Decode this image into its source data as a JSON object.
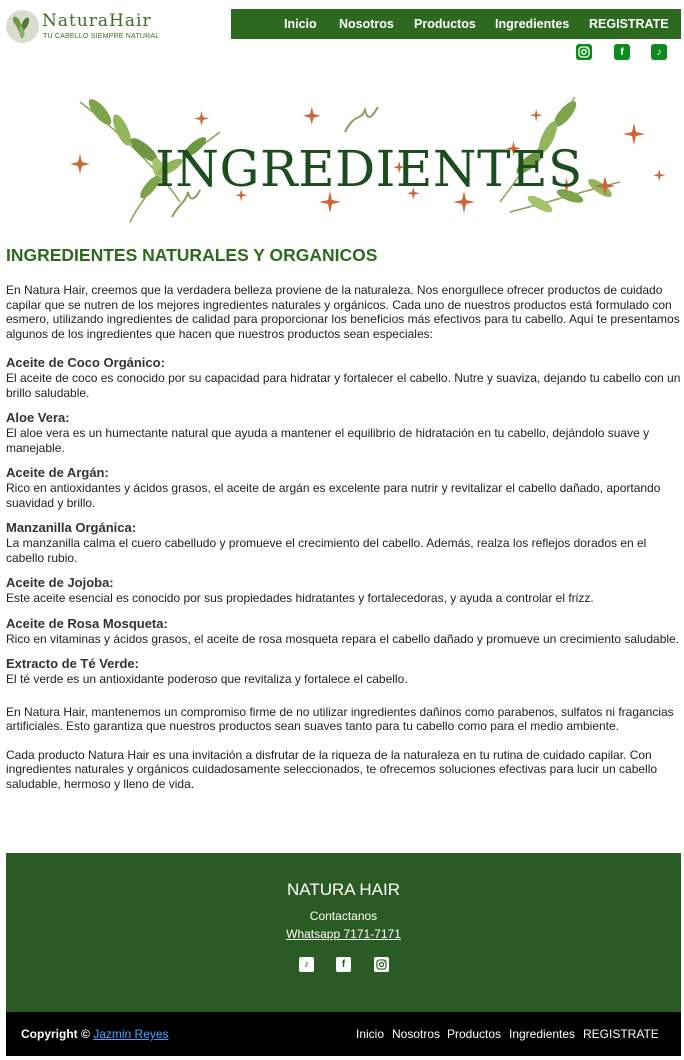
{
  "brand": {
    "name": "NaturaHair",
    "tagline": "TU CABELLO SIEMPRE NATURAL"
  },
  "nav": {
    "items": [
      "Inicio",
      "Nosotros",
      "Productos",
      "Ingredientes",
      "REGISTRATE"
    ]
  },
  "social": {
    "icons": [
      "instagram-icon",
      "facebook-icon",
      "tiktok-icon"
    ]
  },
  "banner": {
    "title": "INGREDIENTES"
  },
  "main": {
    "heading": "INGREDIENTES NATURALES Y ORGANICOS",
    "intro": "En Natura Hair, creemos que la verdadera belleza proviene de la naturaleza. Nos enorgullece ofrecer productos de cuidado capilar que se nutren de los mejores ingredientes naturales y orgánicos. Cada uno de nuestros productos está formulado con esmero, utilizando ingredientes de calidad para proporcionar los beneficios más efectivos para tu cabello. Aquí te presentamos algunos de los ingredientes que hacen que nuestros productos sean especiales:",
    "ingredients": [
      {
        "name": "Aceite de Coco Orgánico:",
        "desc": "El aceite de coco es conocido por su capacidad para hidratar y fortalecer el cabello. Nutre y suaviza, dejando tu cabello con un brillo saludable."
      },
      {
        "name": "Aloe Vera:",
        "desc": "El aloe vera es un humectante natural que ayuda a mantener el equilibrio de hidratación en tu cabello, dejándolo suave y manejable."
      },
      {
        "name": "Aceite de Argán:",
        "desc": "Rico en antioxidantes y ácidos grasos, el aceite de argán es excelente para nutrir y revitalizar el cabello dañado, aportando suavidad y brillo."
      },
      {
        "name": "Manzanilla Orgánica:",
        "desc": "La manzanilla calma el cuero cabelludo y promueve el crecimiento del cabello. Además, realza los reflejos dorados en el cabello rubio."
      },
      {
        "name": "Aceite de Jojoba:",
        "desc": "Este aceite esencial es conocido por sus propiedades hidratantes y fortalecedoras, y ayuda a controlar el frizz."
      },
      {
        "name": "Aceite de Rosa Mosqueta:",
        "desc": "Rico en vitaminas y ácidos grasos, el aceite de rosa mosqueta repara el cabello dañado y promueve un crecimiento saludable."
      },
      {
        "name": "Extracto de Té Verde:",
        "desc": "El té verde es un antioxidante poderoso que revitaliza y fortalece el cabello."
      }
    ],
    "commitment": "En Natura Hair, mantenemos un compromiso firme de no utilizar ingredientes dañinos como parabenos, sulfatos ni fragancias artificiales. Esto garantiza que nuestros productos sean suaves tanto para tu cabello como para el medio ambiente.",
    "closing": "Cada producto Natura Hair es una invitación a disfrutar de la riqueza de la naturaleza en tu rutina de cuidado capilar. Con ingredientes naturales y orgánicos cuidadosamente seleccionados, te ofrecemos soluciones efectivas para lucir un cabello saludable, hermoso y lleno de vida."
  },
  "footer": {
    "brand": "NATURA HAIR",
    "contact_label": "Contactanos",
    "phone": "Whatsapp 7171-7171",
    "copyright": "Copyright ©",
    "author": "Jazmin Reyes"
  },
  "colors": {
    "primary_green": "#2d6a1f",
    "footer_green": "#2b5b24",
    "banner_title": "#1c4d1e",
    "star_orange": "#c9683a",
    "author_link": "#3fa8ff"
  }
}
